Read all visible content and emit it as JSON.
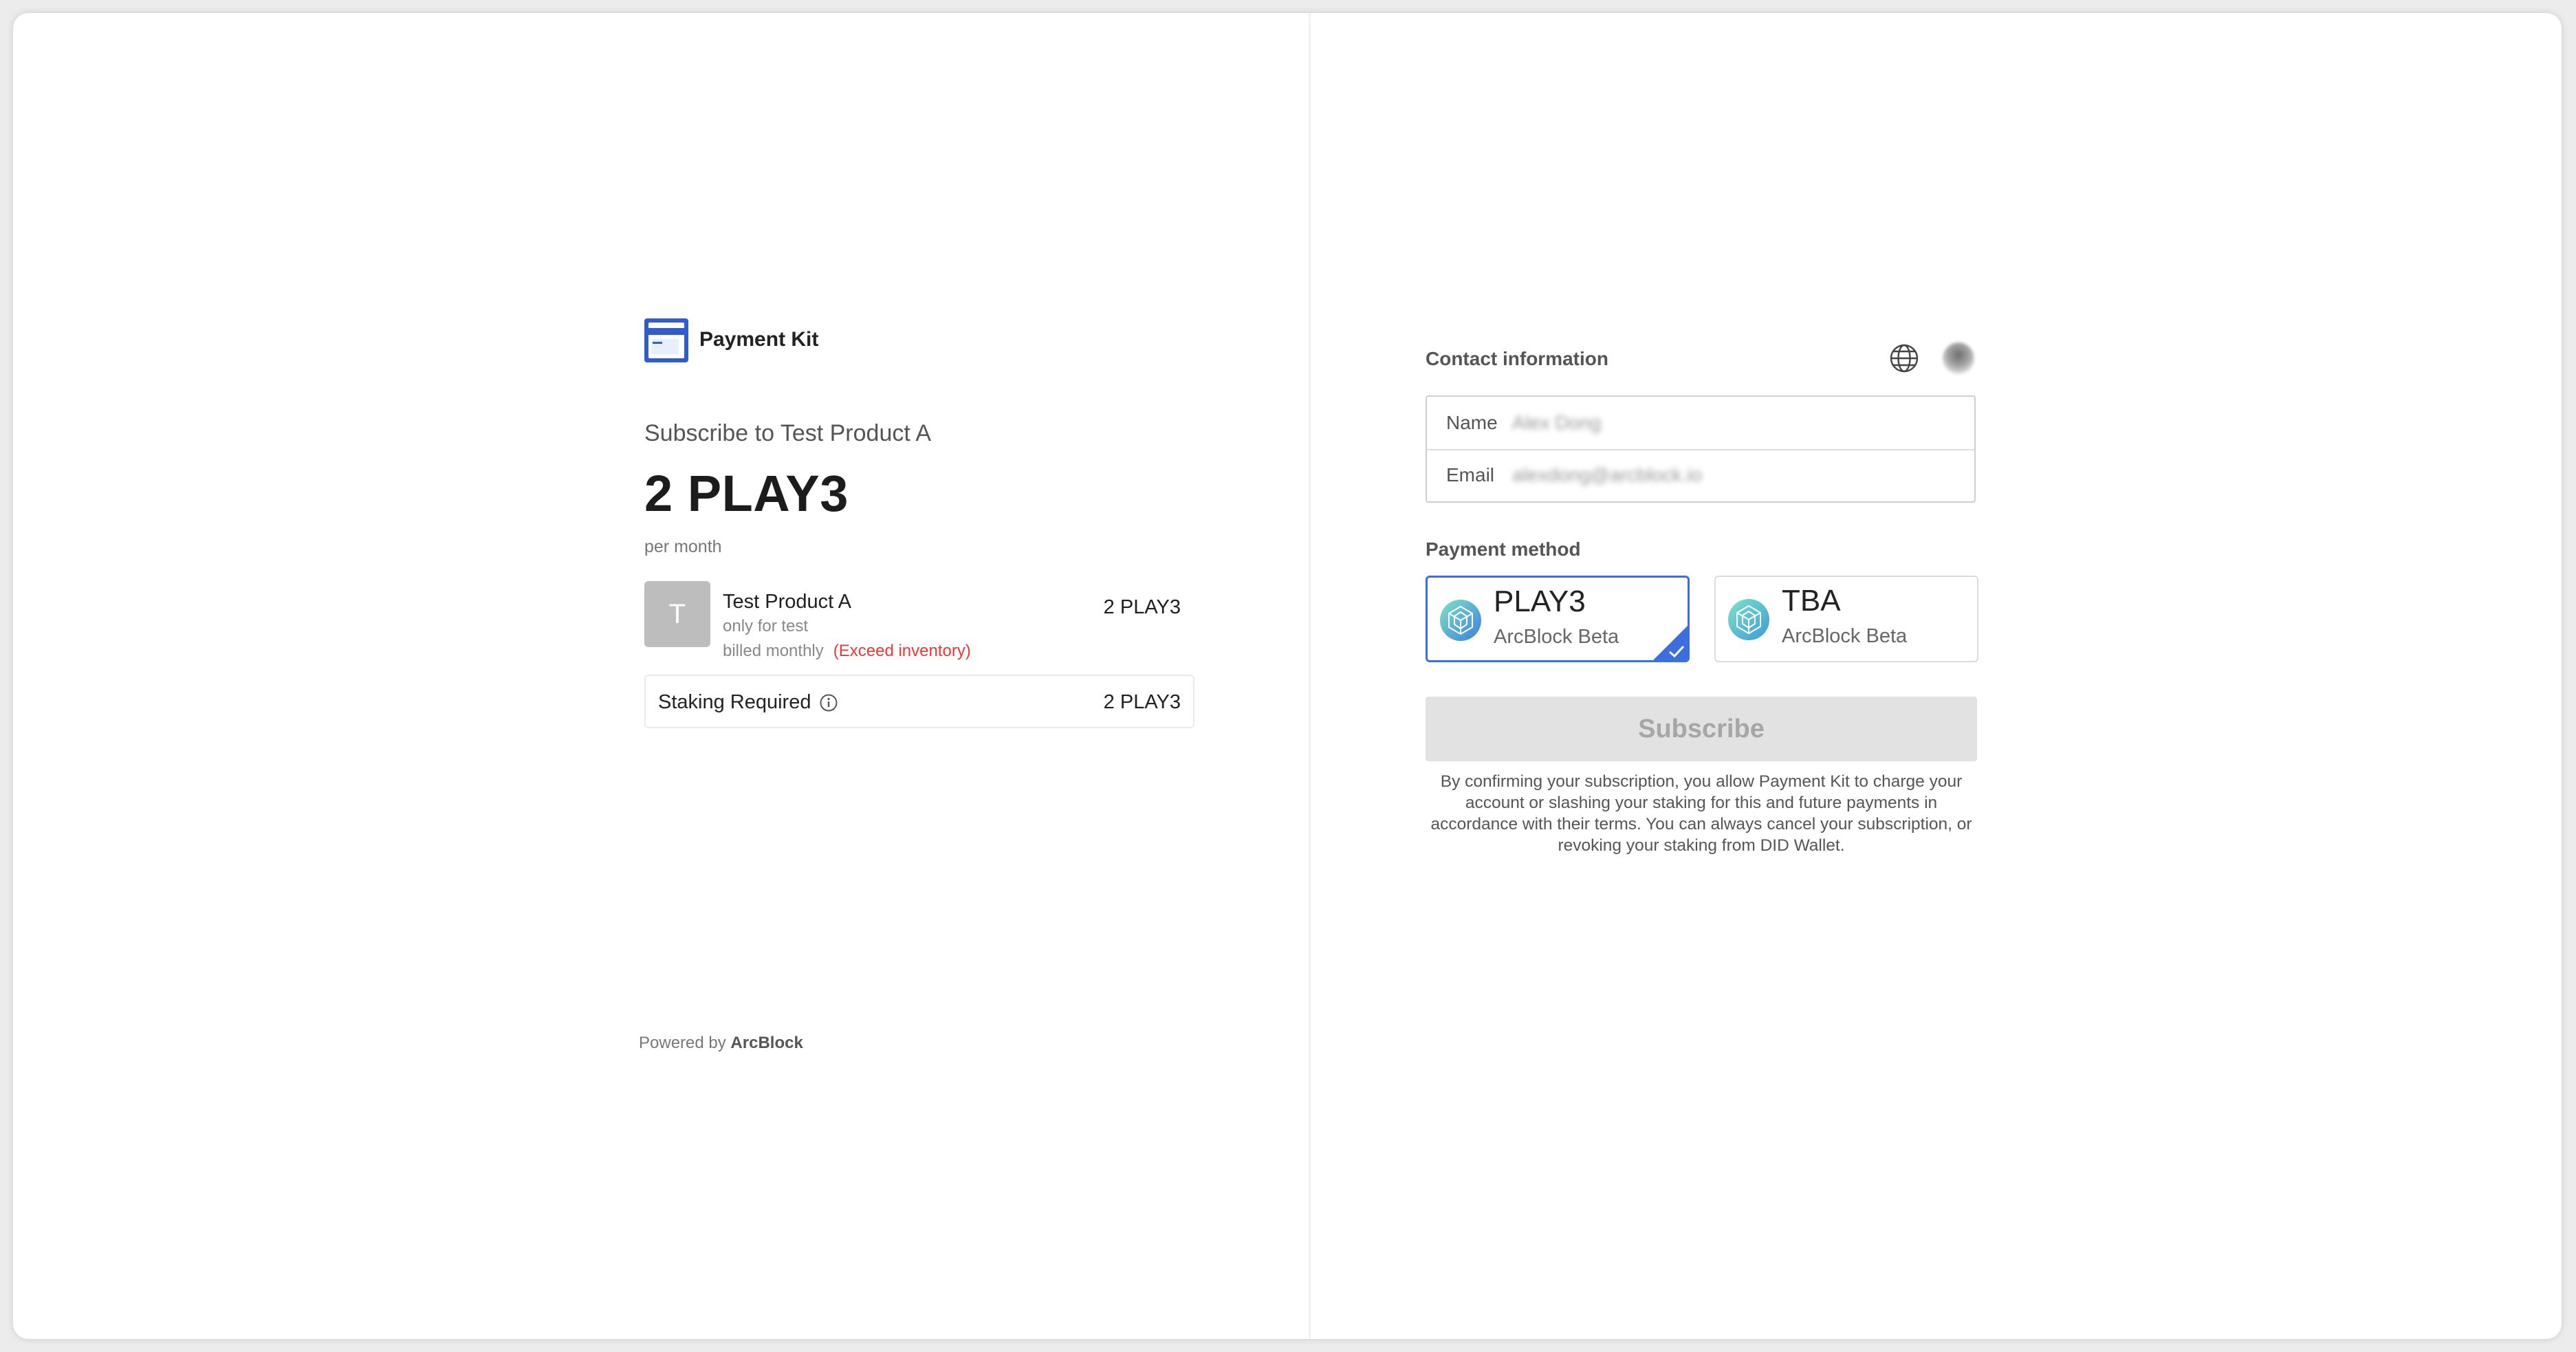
{
  "brand": {
    "name": "Payment Kit",
    "logo_icon": "payment-kit-logo-icon"
  },
  "summary": {
    "title": "Subscribe to Test Product A",
    "price": "2 PLAY3",
    "period": "per month"
  },
  "product": {
    "avatar_letter": "T",
    "name": "Test Product A",
    "description": "only for test",
    "billing": "billed monthly",
    "warning": "(Exceed inventory)",
    "price": "2 PLAY3"
  },
  "staking": {
    "label": "Staking Required",
    "value": "2 PLAY3",
    "icon": "info-icon"
  },
  "footer": {
    "powered_prefix": "Powered by",
    "powered_brand": "ArcBlock"
  },
  "contact": {
    "title": "Contact information",
    "language_icon": "globe-icon",
    "name_label": "Name",
    "name_value": "Alex Dong",
    "email_label": "Email",
    "email_value": "alexdong@arcblock.io"
  },
  "payment": {
    "title": "Payment method",
    "methods": [
      {
        "symbol": "PLAY3",
        "network": "ArcBlock Beta",
        "selected": true
      },
      {
        "symbol": "TBA",
        "network": "ArcBlock Beta",
        "selected": false
      }
    ]
  },
  "actions": {
    "subscribe_label": "Subscribe"
  },
  "terms": "By confirming your subscription, you allow Payment Kit to charge your account or slashing your staking for this and future payments in accordance with their terms. You can always cancel your subscription, or revoking your staking from DID Wallet.",
  "colors": {
    "accent": "#3b6fe0",
    "warning": "#e53935",
    "button_disabled_bg": "#e2e2e2",
    "button_disabled_text": "#a6a6a6"
  }
}
